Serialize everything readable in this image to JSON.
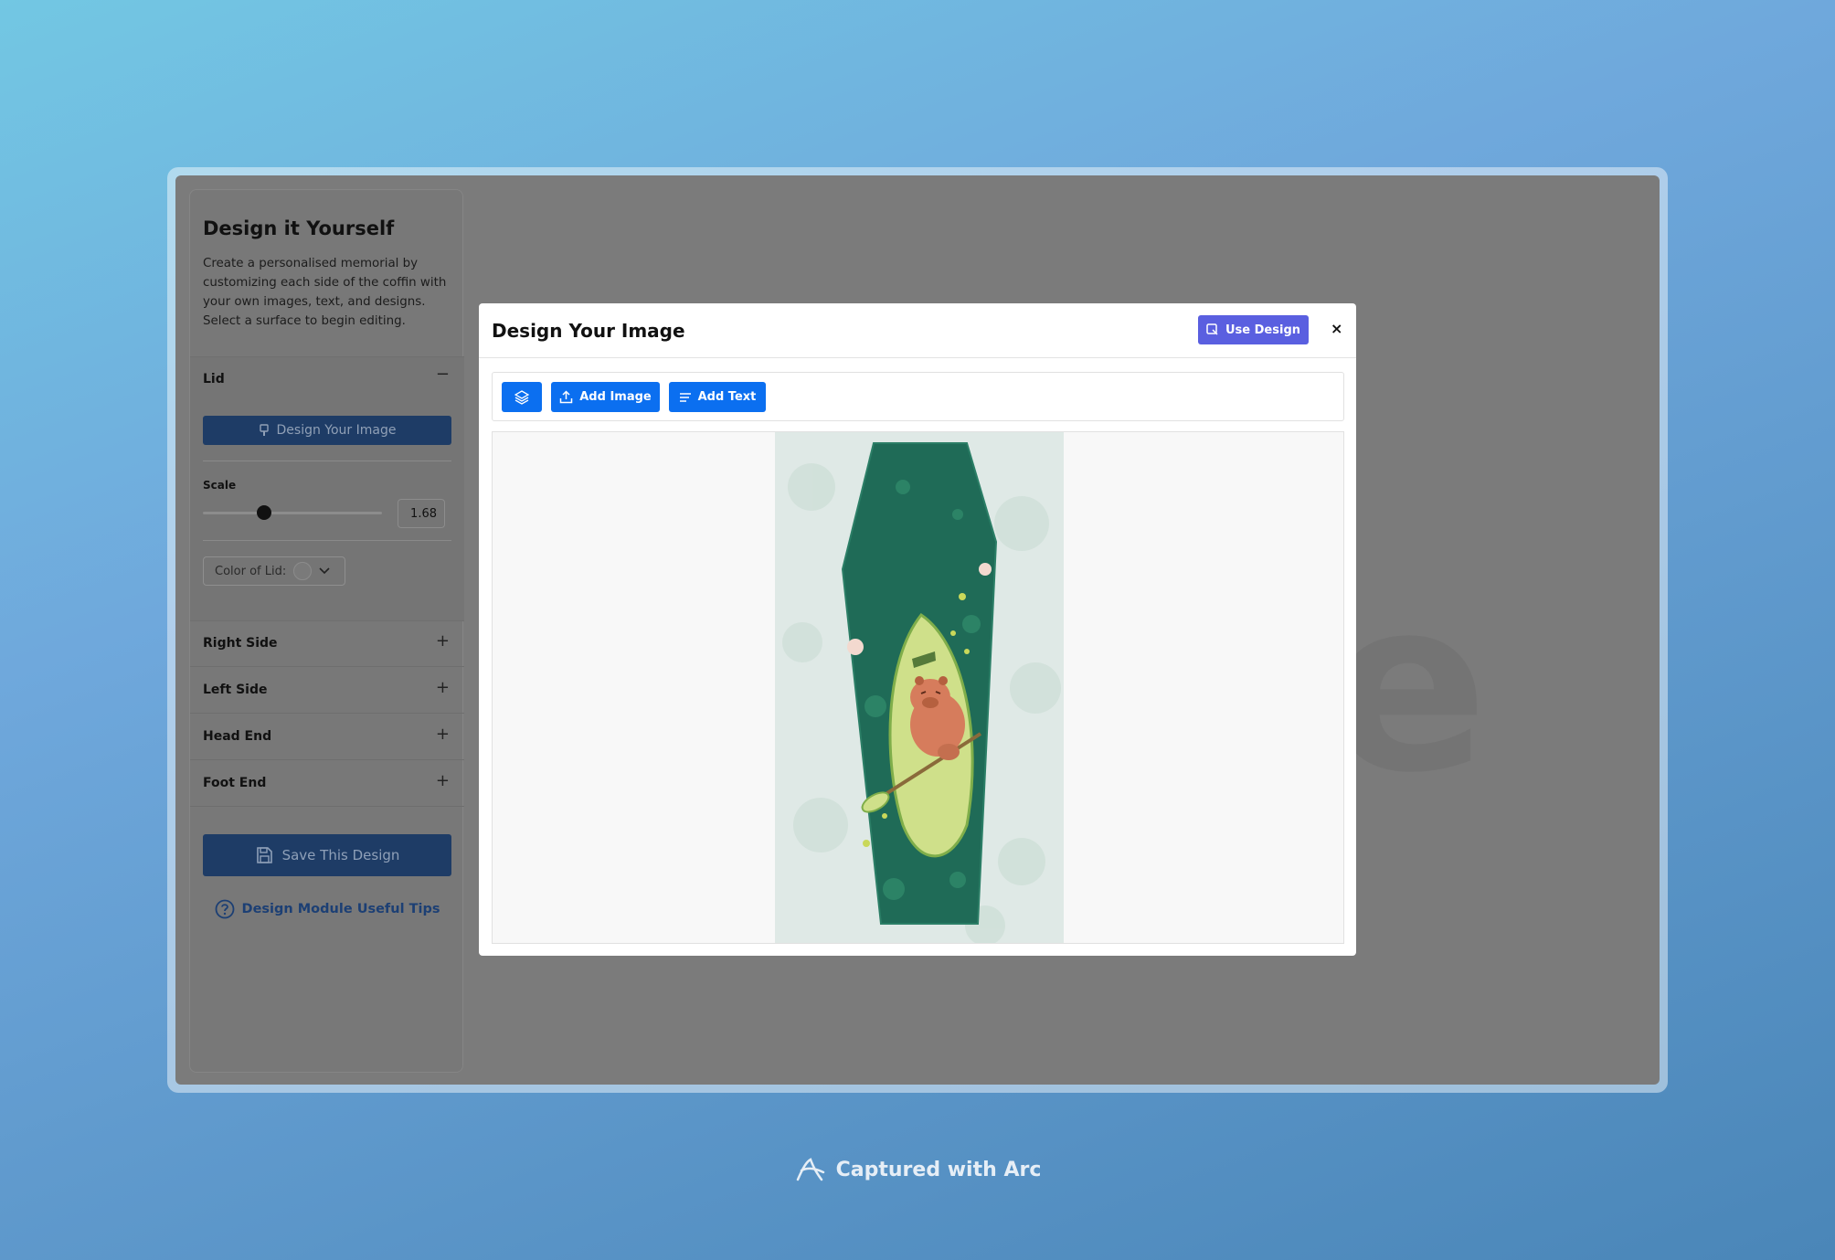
{
  "sidebar": {
    "title": "Design it Yourself",
    "description": "Create a personalised memorial by customizing each side of the coffin with your own images, text, and designs. Select a surface to begin editing.",
    "lid": {
      "label": "Lid",
      "toggle": "−",
      "design_button": "Design Your Image",
      "scale_label": "Scale",
      "scale_value": "1.68",
      "scale_fraction": 0.34,
      "color_label": "Color of Lid:"
    },
    "sections": [
      {
        "label": "Right Side",
        "toggle": "+"
      },
      {
        "label": "Left Side",
        "toggle": "+"
      },
      {
        "label": "Head End",
        "toggle": "+"
      },
      {
        "label": "Foot End",
        "toggle": "+"
      }
    ],
    "save_button": "Save This Design",
    "tips_link": "Design Module Useful Tips"
  },
  "modal": {
    "title": "Design Your Image",
    "use_button": "Use Design",
    "close": "×",
    "toolbar": {
      "add_image": "Add Image",
      "add_text": "Add Text"
    }
  },
  "watermark": "Captured with Arc",
  "colors": {
    "primary_blue": "#0b6ff0",
    "use_design_purple": "#5a5fe0",
    "overlay_gray": "#7b7b7b"
  },
  "icons": [
    "layers-icon",
    "upload-icon",
    "text-lines-icon",
    "use-design-icon",
    "close-icon",
    "save-icon",
    "help-icon",
    "arc-logo-icon"
  ]
}
